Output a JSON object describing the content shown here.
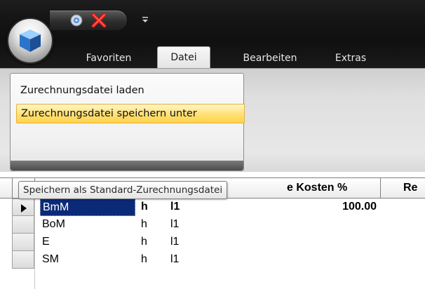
{
  "ribbon": {
    "tabs": [
      "Favoriten",
      "Datei",
      "Bearbeiten",
      "Extras"
    ],
    "active_tab": "Datei"
  },
  "menu": {
    "items": [
      "Zurechnungsdatei laden",
      "Zurechnungsdatei speichern unter"
    ],
    "highlighted_item": "Zurechnungsdatei speichern unter"
  },
  "tooltip": {
    "text": "Speichern als Standard-Zurechnungsdatei"
  },
  "grid": {
    "visible_headers": [
      "e Kosten %",
      "Re"
    ],
    "rows": [
      {
        "code": "BmM",
        "unit": "h",
        "level": "l1",
        "percent": "100.00",
        "current": true
      },
      {
        "code": "BoM",
        "unit": "h",
        "level": "l1",
        "percent": "",
        "current": false
      },
      {
        "code": "E",
        "unit": "h",
        "level": "l1",
        "percent": "",
        "current": false
      },
      {
        "code": "SM",
        "unit": "h",
        "level": "l1",
        "percent": "",
        "current": false
      }
    ]
  },
  "colors": {
    "highlight": "#ffe27a",
    "selection": "#0a2a78",
    "title_bar": "#141414"
  },
  "icons": [
    "office-orb-cube-icon",
    "disc-icon",
    "red-x-icon",
    "customize-dropdown-icon",
    "current-row-arrow-icon"
  ]
}
